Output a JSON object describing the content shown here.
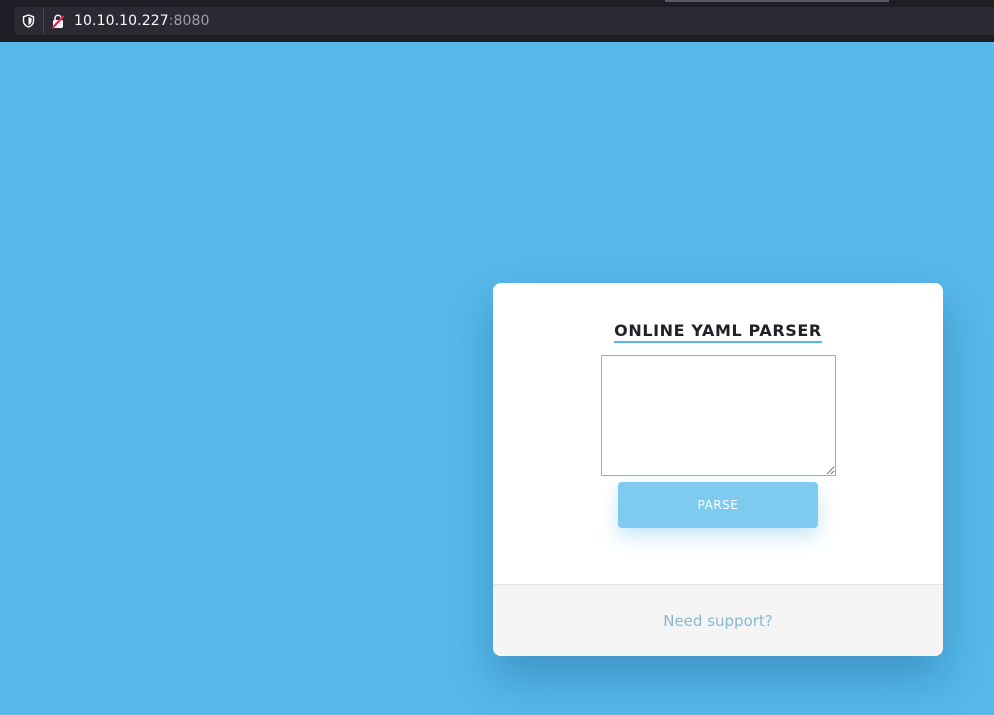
{
  "browser": {
    "url_host": "10.10.10.227",
    "url_port": ":8080",
    "icons": {
      "tracking": "shield-icon",
      "security": "insecure-lock-icon"
    }
  },
  "page": {
    "background_color": "#56b8eb",
    "card": {
      "title": "ONLINE YAML PARSER",
      "textarea_value": "",
      "button_label": "PARSE",
      "footer_link": "Need support?"
    },
    "colors": {
      "accent": "#56b8eb",
      "button": "#7fcbf0",
      "link": "#8ab6d6"
    }
  }
}
